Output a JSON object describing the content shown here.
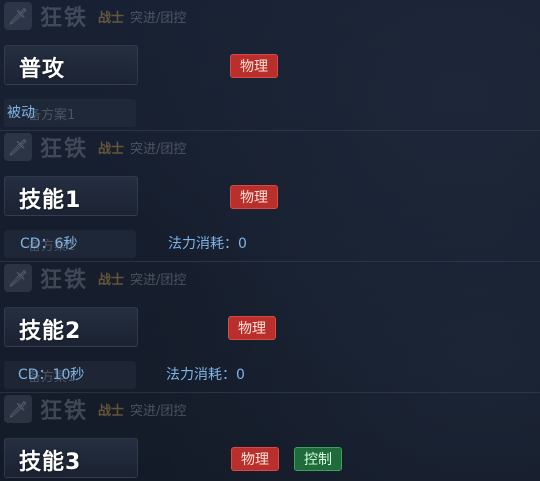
{
  "hero": {
    "name": "狂铁",
    "class": "战士",
    "role": "突进/团控",
    "plan_label": "备方案1"
  },
  "skills": [
    {
      "title": "普攻",
      "tags": [
        "物理"
      ],
      "info": [
        "被动"
      ]
    },
    {
      "title": "技能1",
      "tags": [
        "物理"
      ],
      "info": [
        "CD：6秒",
        "法力消耗：0"
      ]
    },
    {
      "title": "技能2",
      "tags": [
        "物理"
      ],
      "info": [
        "CD：10秒",
        "法力消耗：0"
      ]
    },
    {
      "title": "技能3",
      "tags": [
        "物理",
        "控制"
      ],
      "info": []
    }
  ],
  "colors": {
    "physical_tag": "#b82f2b",
    "control_tag": "#1f6b3c",
    "info_text": "#7fb4e6",
    "class_text": "#c49646"
  }
}
